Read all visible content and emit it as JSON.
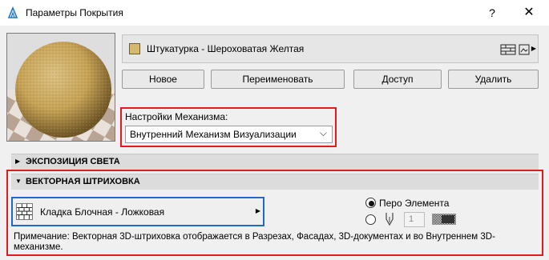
{
  "window": {
    "title": "Параметры Покрытия",
    "help_label": "?",
    "close_label": "✕"
  },
  "material": {
    "name": "Штукатурка - Шероховатая Желтая",
    "swatch_color": "#d5b96f"
  },
  "buttons": {
    "new": "Новое",
    "rename": "Переименовать",
    "access": "Доступ",
    "delete": "Удалить"
  },
  "engine": {
    "label": "Настройки Механизма:",
    "selected": "Внутренний Механизм Визуализации"
  },
  "sections": {
    "light": "ЭКСПОЗИЦИЯ СВЕТА",
    "hatch": "ВЕКТОРНАЯ ШТРИХОВКА"
  },
  "hatch": {
    "fill_name": "Кладка Блочная - Ложковая",
    "pen_option_label": "Перо Элемента",
    "pen_number": "1",
    "note": "Примечание: Векторная 3D-штриховка отображается в Разрезах, Фасадах, 3D-документах и во Внутреннем 3D-механизме."
  },
  "colors": {
    "highlight_red": "#e31b1b",
    "focus_blue": "#1e6ac7"
  }
}
